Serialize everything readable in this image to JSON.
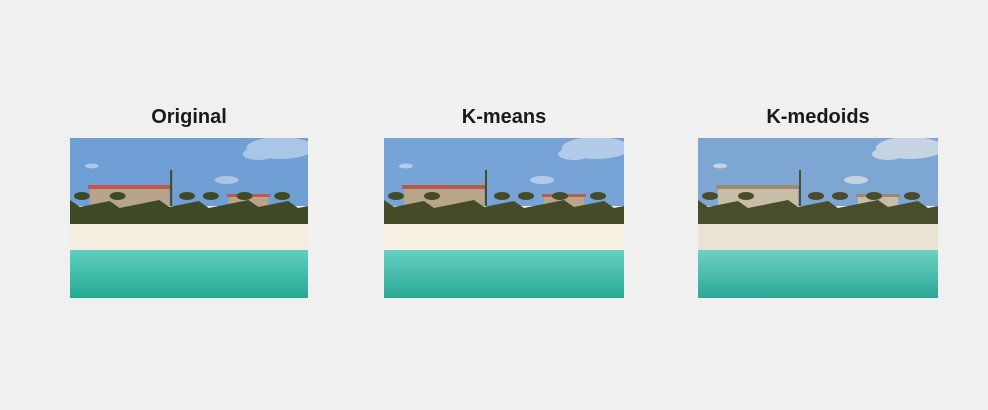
{
  "figure": {
    "panels": [
      {
        "title": "Original",
        "palette": {
          "sky": "#6f9fd4",
          "sky_light": "#a9c6e6",
          "sand": "#f4eee0",
          "sea_top": "#5fcfc0",
          "sea_bottom": "#25a993",
          "trees": "#3d4a25",
          "building": "#b8a48a",
          "roof": "#c0574a"
        }
      },
      {
        "title": "K-means",
        "palette": {
          "sky": "#78a3d6",
          "sky_light": "#b2cbe8",
          "sand": "#f6f0e3",
          "sea_top": "#66d0c2",
          "sea_bottom": "#2aa996",
          "trees": "#434b28",
          "building": "#b7a689",
          "roof": "#b65c48"
        }
      },
      {
        "title": "K-medoids",
        "palette": {
          "sky": "#7ea6d3",
          "sky_light": "#c5d3e2",
          "sand": "#e9e3d3",
          "sea_top": "#6fd1c4",
          "sea_bottom": "#2ca797",
          "trees": "#4a4d2c",
          "building": "#c8bda6",
          "roof": "#9a8a6f"
        }
      }
    ]
  }
}
